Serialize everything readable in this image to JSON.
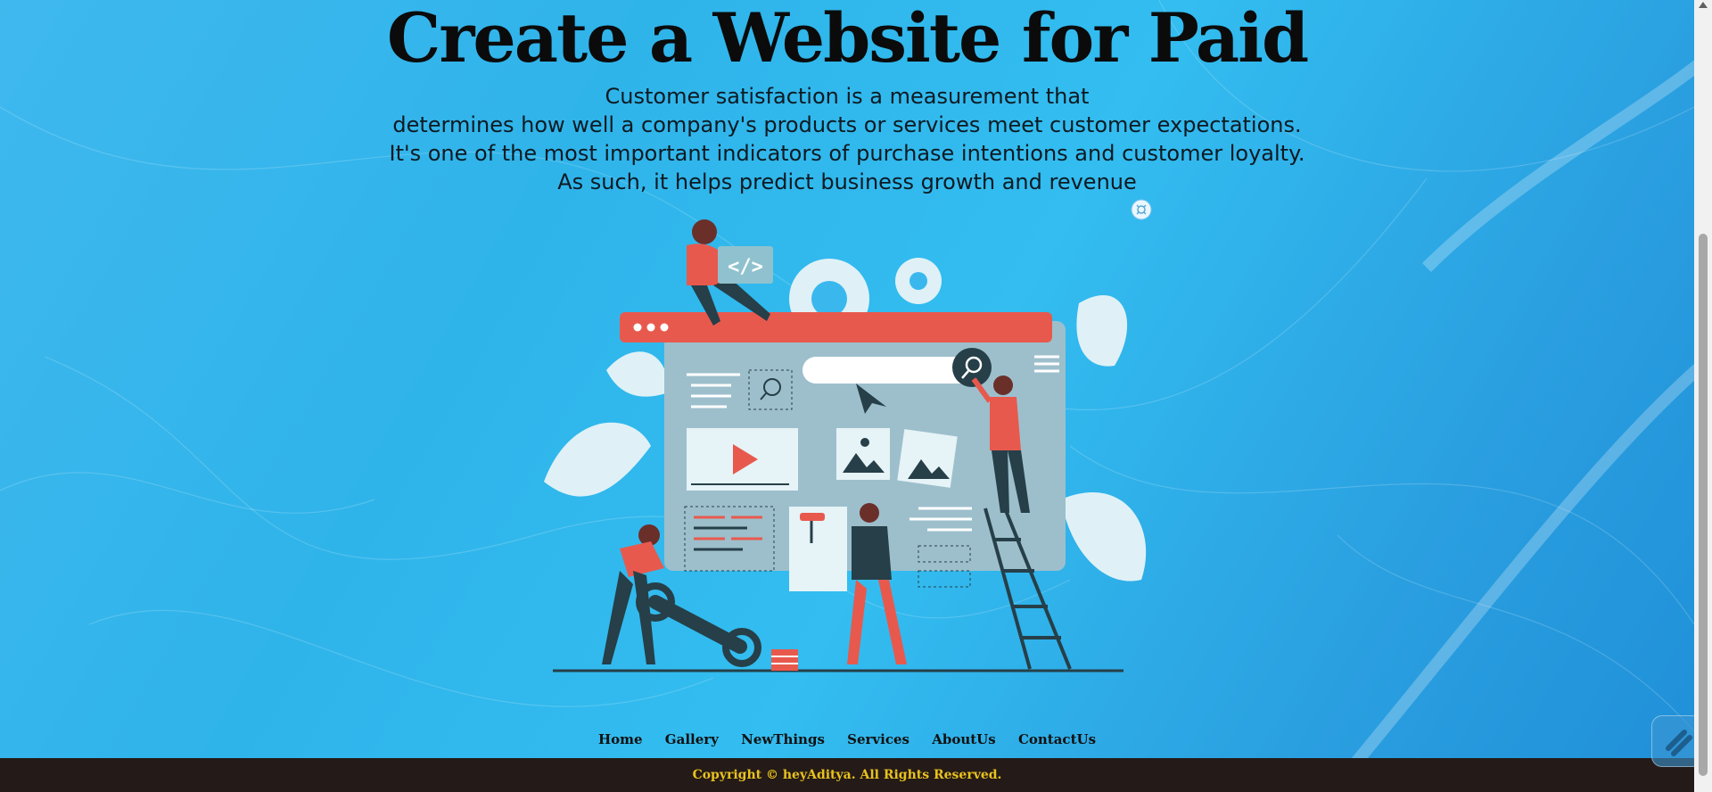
{
  "hero": {
    "title": "Create a Website for Paid",
    "description_lines": [
      "Customer satisfaction is a measurement that",
      "determines how well a company's products or services meet customer expectations.",
      "It's one of the most important indicators of purchase intentions and customer loyalty.",
      "As such, it helps predict business growth and revenue"
    ],
    "illustration_code_tag": "</>"
  },
  "nav": {
    "items": [
      "Home",
      "Gallery",
      "NewThings",
      "Services",
      "AboutUs",
      "ContactUs"
    ]
  },
  "footer": {
    "copyright": "Copyright © heyAditya. All Rights Reserved."
  },
  "colors": {
    "accent_red": "#e8594d",
    "panel": "#9dbfcc",
    "dark": "#263f48",
    "copyright_text": "#e8c21e",
    "footer_bg": "#241a17"
  },
  "icons": {
    "target": "focus-ring-icon",
    "widget": "app-launcher-icon"
  }
}
